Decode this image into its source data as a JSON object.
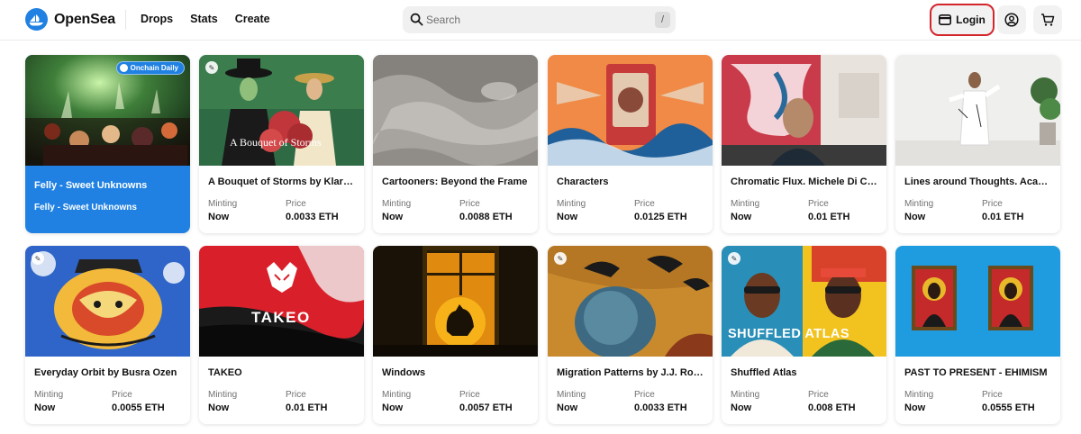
{
  "header": {
    "brand": "OpenSea",
    "nav": [
      "Drops",
      "Stats",
      "Create"
    ],
    "search_placeholder": "Search",
    "search_shortcut": "/",
    "login_label": "Login",
    "profile_icon": "profile-icon",
    "cart_icon": "cart-icon"
  },
  "colors": {
    "accent": "#2081e2",
    "login_outline": "#d3262c"
  },
  "featured": {
    "badge": "Onchain Daily",
    "title": "Felly - Sweet Unknowns",
    "subtitle": "Felly - Sweet Unknowns"
  },
  "labels": {
    "minting": "Minting",
    "price": "Price",
    "status": "Now"
  },
  "cards": [
    {
      "title": "A Bouquet of Storms by Klara ...",
      "status": "Now",
      "price": "0.0033 ETH",
      "overlay": "A Bouquet of Storms"
    },
    {
      "title": "Cartooners: Beyond the Frame",
      "status": "Now",
      "price": "0.0088 ETH"
    },
    {
      "title": "Characters",
      "status": "Now",
      "price": "0.0125 ETH"
    },
    {
      "title": "Chromatic Flux. Michele Di Co...",
      "status": "Now",
      "price": "0.01 ETH"
    },
    {
      "title": "Lines around Thoughts. Acaci...",
      "status": "Now",
      "price": "0.01 ETH"
    },
    {
      "title": "Everyday Orbit by Busra Ozen",
      "status": "Now",
      "price": "0.0055 ETH"
    },
    {
      "title": "TAKEO",
      "status": "Now",
      "price": "0.01 ETH",
      "overlay": "TAKEO"
    },
    {
      "title": "Windows",
      "status": "Now",
      "price": "0.0057 ETH"
    },
    {
      "title": "Migration Patterns by J.J. Roads",
      "status": "Now",
      "price": "0.0033 ETH"
    },
    {
      "title": "Shuffled Atlas",
      "status": "Now",
      "price": "0.008 ETH",
      "overlay": "SHUFFLED ATLAS"
    },
    {
      "title": "PAST TO PRESENT - EHIMISM",
      "status": "Now",
      "price": "0.0555 ETH"
    }
  ]
}
